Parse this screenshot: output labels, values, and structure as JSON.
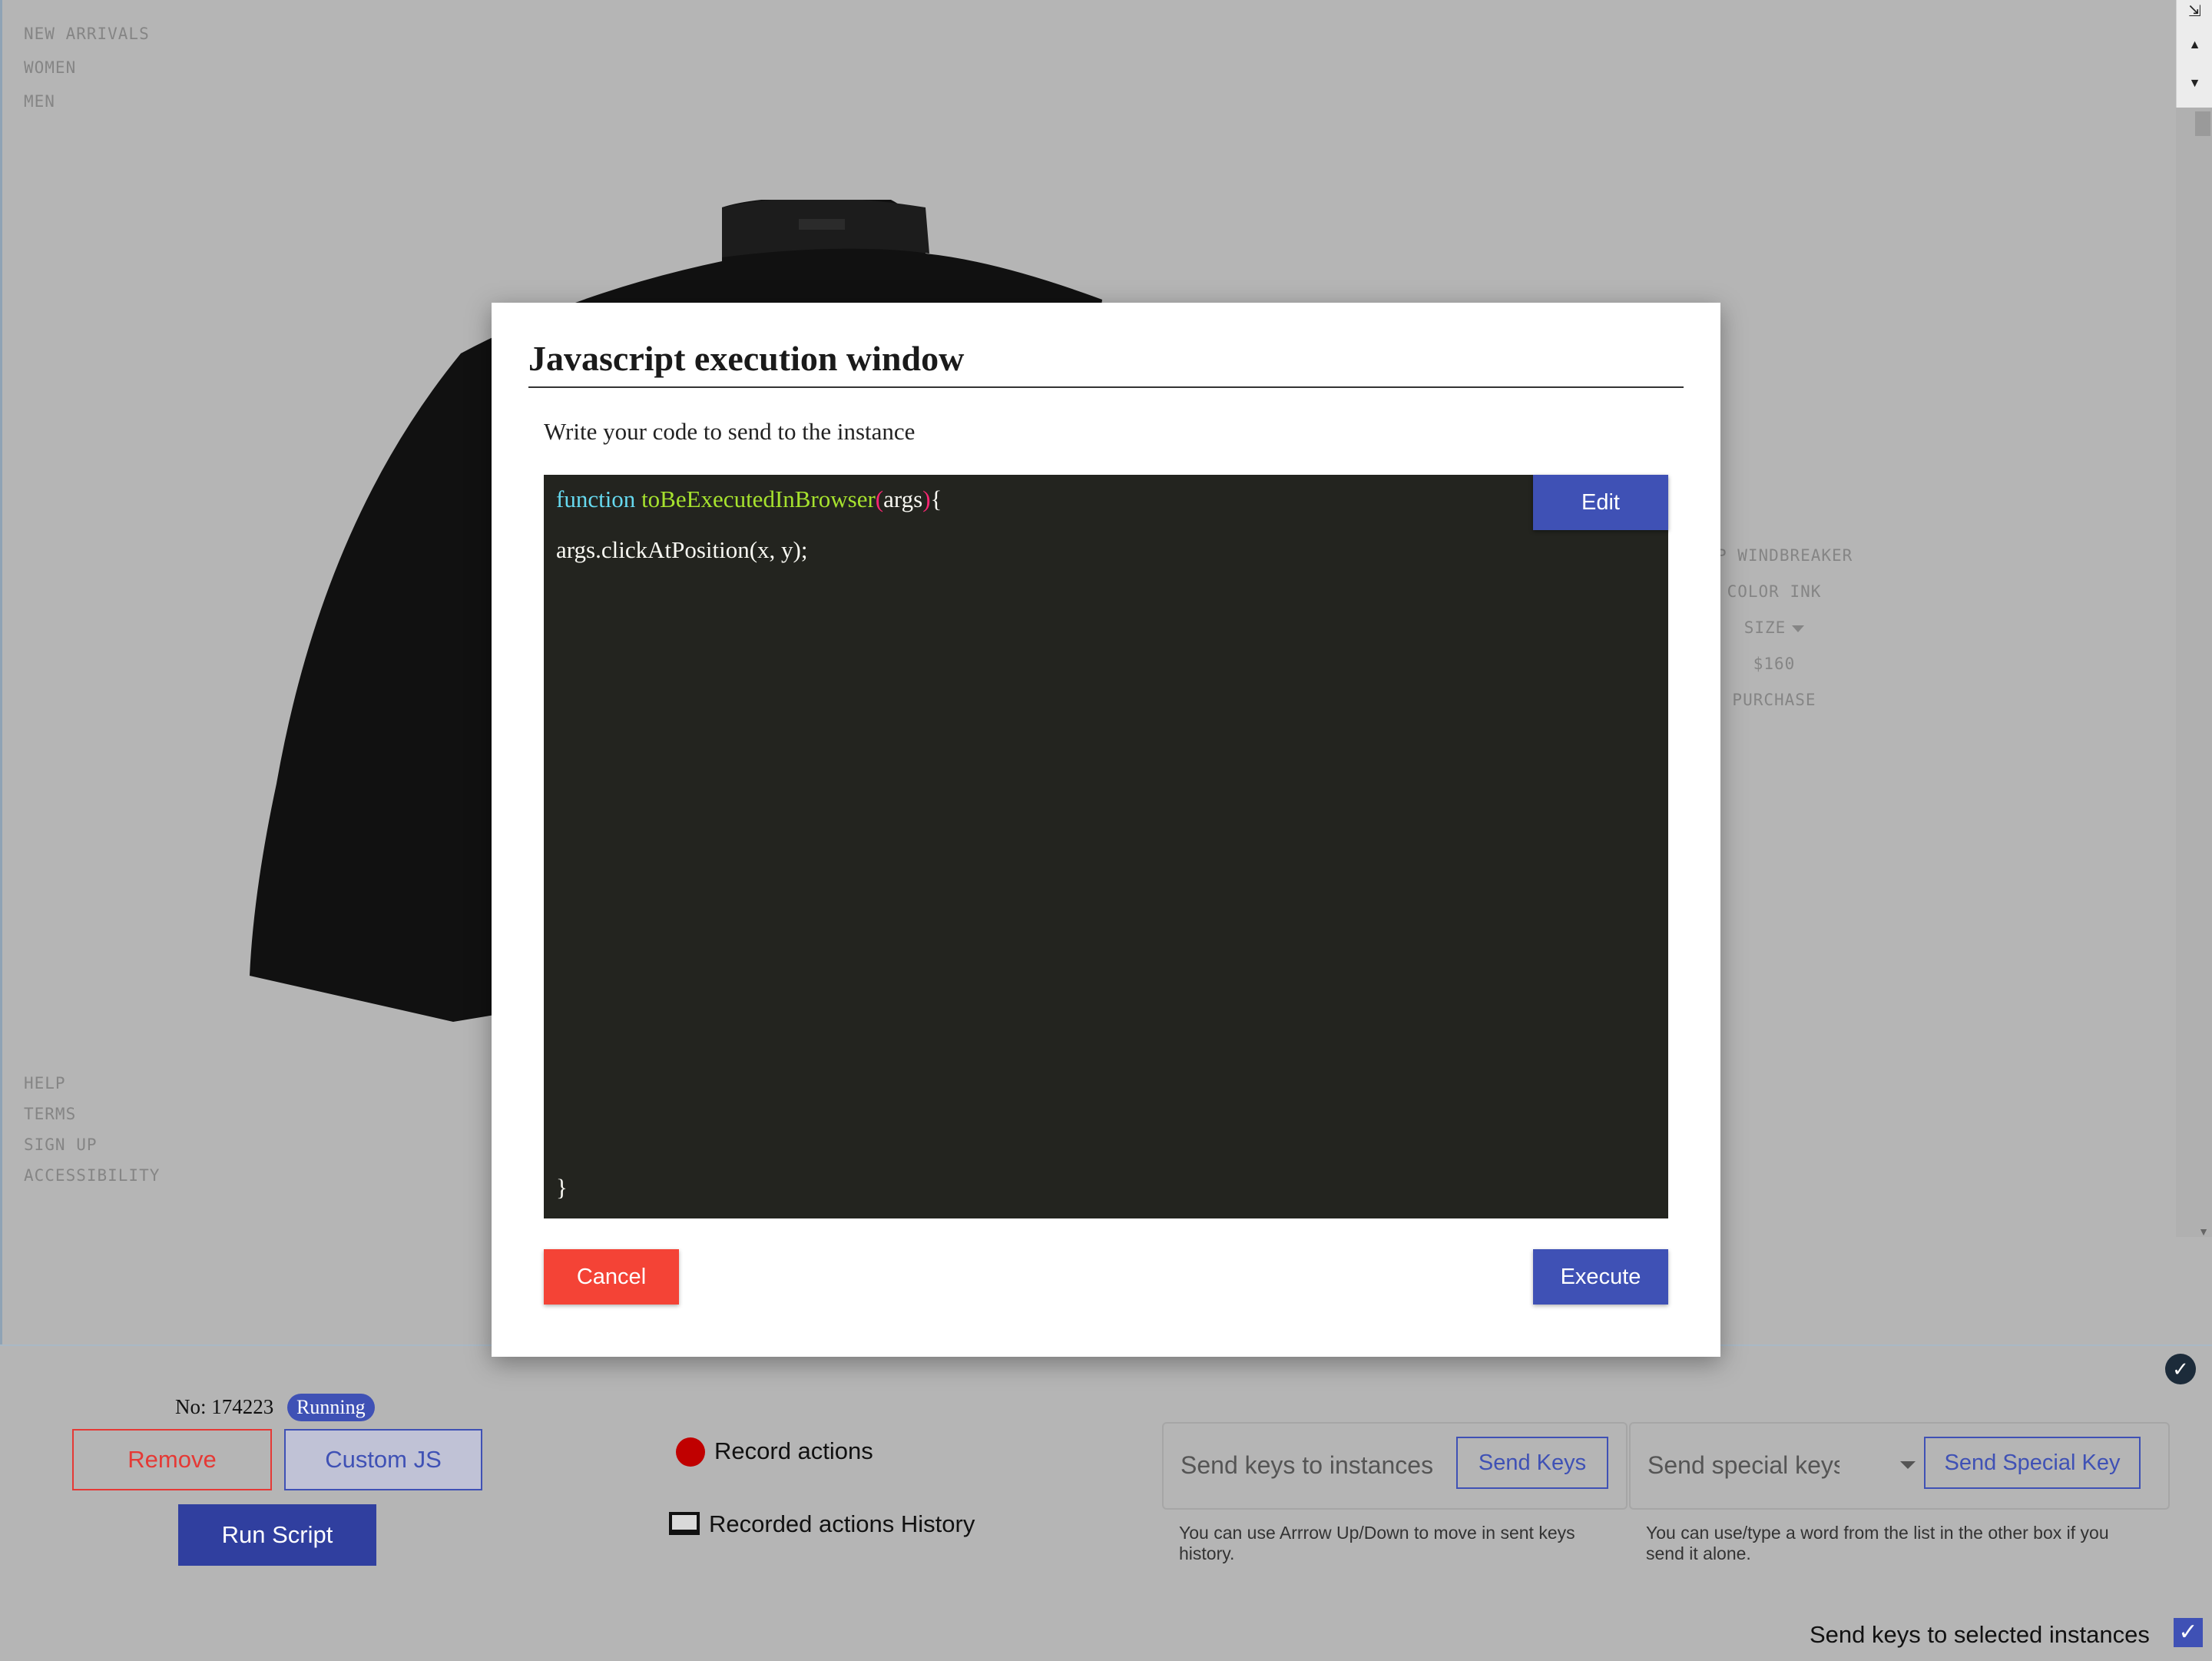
{
  "site": {
    "nav": [
      "NEW ARRIVALS",
      "WOMEN",
      "MEN"
    ],
    "footer": [
      "HELP",
      "TERMS",
      "SIGN UP",
      "ACCESSIBILITY"
    ],
    "product": {
      "name": "ZIP WINDBREAKER",
      "color": "COLOR INK",
      "size": "SIZE",
      "price": "$160",
      "purchase": "PURCHASE"
    }
  },
  "modal": {
    "title": "Javascript execution window",
    "subtitle": "Write your code to send to the instance",
    "edit_label": "Edit",
    "code": {
      "keyword": "function",
      "fn_name": "toBeExecutedInBrowser",
      "open_paren": "(",
      "param": "args",
      "close_paren": ")",
      "open_brace": "{",
      "line2": "args.clickAtPosition(x, y);",
      "close_brace": "}"
    },
    "cancel_label": "Cancel",
    "execute_label": "Execute"
  },
  "panel": {
    "instance_label": "No: 174223",
    "status": "Running",
    "remove_label": "Remove",
    "custom_js_label": "Custom JS",
    "run_script_label": "Run Script",
    "record_label": "Record actions",
    "history_label": "Recorded actions History",
    "send_keys_placeholder": "Send keys to instances",
    "send_keys_button": "Send Keys",
    "send_keys_hint": "You can use Arrrow Up/Down to move in sent keys history.",
    "special_keys_placeholder": "Send special keys t…",
    "send_special_button": "Send Special Key",
    "special_hint": "You can use/type a word from the list in the other box if you send it alone.",
    "selected_label": "Send keys to selected instances"
  },
  "colors": {
    "primary": "#3f51b5",
    "danger": "#f44336",
    "record": "#c00000",
    "editor_bg": "#23241f"
  }
}
